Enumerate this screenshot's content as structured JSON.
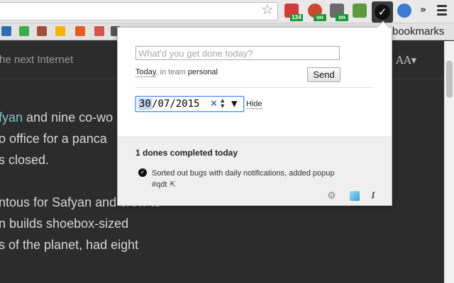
{
  "browser": {
    "extensions": [
      {
        "name": "red-cross-extension",
        "color": "#d63b3b",
        "badge": "134"
      },
      {
        "name": "clock-extension",
        "color": "#c94a2f",
        "badge": "on"
      },
      {
        "name": "tool-extension",
        "color": "#6b6b6b",
        "badge": "on"
      },
      {
        "name": "checklist-extension",
        "color": "#5a9b3e",
        "badge": ""
      },
      {
        "name": "idonethis-extension",
        "color": "#111111",
        "badge": ""
      },
      {
        "name": "shield-extension",
        "color": "#3b7bd4",
        "badge": ""
      }
    ],
    "active_extension_glyph": "✓",
    "overflow_glyph": "»"
  },
  "bookmarks_bar": {
    "trailing_label": "bookmarks",
    "icon_colors": [
      "#2d6fb4",
      "#3cab4c",
      "#a54d37",
      "#f4b400",
      "#e65d1b",
      "#d9534f",
      "#555555"
    ]
  },
  "page": {
    "subtitle": "he next Internet",
    "font_size_label": "AA▾",
    "article_lines": [
      {
        "pre": "",
        "hl": "fyan",
        "post": " and nine co-wo"
      },
      {
        "pre": "o office for a panca",
        "hl": "",
        "post": ""
      },
      {
        "pre": "s closed.",
        "hl": "",
        "post": ""
      },
      {
        "pre": "ntous for Safyan and crew to",
        "hl": "",
        "post": ""
      },
      {
        "pre": "n builds shoebox-sized",
        "hl": "",
        "post": ""
      },
      {
        "pre": "s of the planet, had eight",
        "hl": "",
        "post": ""
      }
    ]
  },
  "popup": {
    "input_placeholder": "What'd you get done today?",
    "date_label": "Today",
    "team_prefix": ", in team ",
    "team_name": "personal",
    "send_label": "Send",
    "date_day": "30",
    "date_rest": "/07/2015",
    "date_clear_glyph": "×",
    "date_spin_glyph": "▲",
    "date_spin_glyph_down": "▼",
    "date_dropdown_glyph": "▼",
    "hide_label": "Hide",
    "completed_count": "1 dones completed today",
    "done_item_text": "Sorted out bugs with daily notifications, added popup",
    "done_item_tag": "#qdt",
    "external_link_glyph": "⇱",
    "footer_icons": {
      "gear": "⚙",
      "idt": "ꭍ"
    }
  }
}
